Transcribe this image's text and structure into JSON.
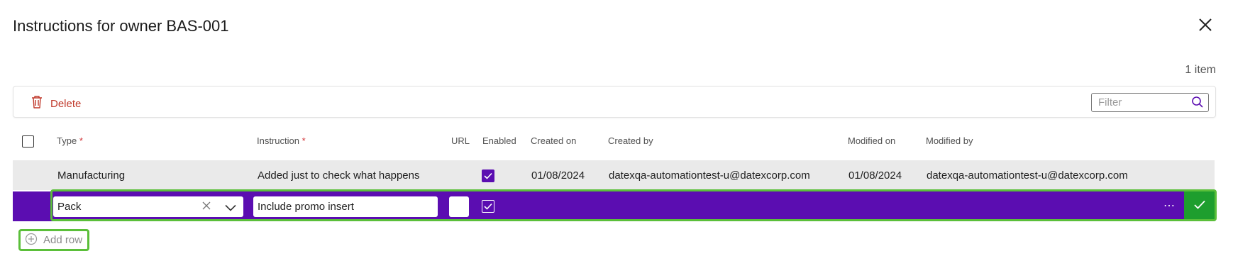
{
  "dialog": {
    "title": "Instructions for owner BAS-001",
    "item_count": "1 item"
  },
  "toolbar": {
    "delete_label": "Delete",
    "filter_placeholder": "Filter"
  },
  "table": {
    "columns": {
      "type": "Type",
      "instruction": "Instruction",
      "url": "URL",
      "enabled": "Enabled",
      "created_on": "Created on",
      "created_by": "Created by",
      "modified_on": "Modified on",
      "modified_by": "Modified by"
    },
    "required_marker": "*",
    "rows": [
      {
        "type": "Manufacturing",
        "instruction": "Added just to check what happens",
        "url": "",
        "enabled": true,
        "created_on": "01/08/2024",
        "created_by": "datexqa-automationtest-u@datexcorp.com",
        "modified_on": "01/08/2024",
        "modified_by": "datexqa-automationtest-u@datexcorp.com"
      }
    ],
    "edit_row": {
      "type": "Pack",
      "instruction": "Include promo insert",
      "url": "",
      "enabled": true
    }
  },
  "add_row_label": "Add row",
  "colors": {
    "accent": "#5b0db1",
    "confirm": "#1e9e2e",
    "highlight": "#5bbf3a",
    "delete": "#c0392b"
  }
}
